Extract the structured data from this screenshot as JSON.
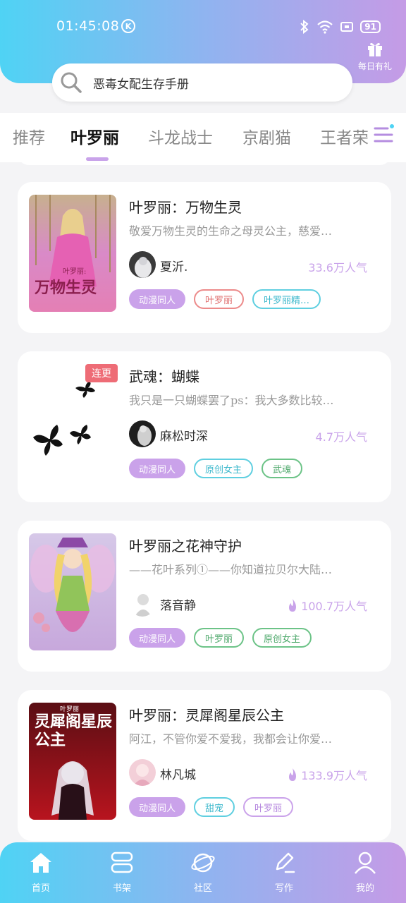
{
  "status_bar": {
    "time": "01:45:08",
    "k_icon": "K",
    "battery": "91"
  },
  "header": {
    "gift_label": "每日有礼"
  },
  "search": {
    "text": "恶毒女配生存手册"
  },
  "tabs": [
    {
      "label": "推荐",
      "active": false
    },
    {
      "label": "叶罗丽",
      "active": true
    },
    {
      "label": "斗龙战士",
      "active": false
    },
    {
      "label": "京剧猫",
      "active": false
    },
    {
      "label": "王者荣",
      "active": false
    }
  ],
  "books": [
    {
      "title": "叶罗丽：万物生灵",
      "desc": "敬爱万物生灵的生命之母灵公主，慈爱…",
      "author": "夏沂.",
      "popularity": "33.6万人气",
      "hot": false,
      "badge": "",
      "cover_title": "万物生灵",
      "cover_sub": "叶罗丽:",
      "tags": [
        "动漫同人",
        "叶罗丽",
        "叶罗丽精…"
      ]
    },
    {
      "title": "武魂：蝴蝶",
      "desc": "我只是一只蝴蝶罢了ps：我大多数比较…",
      "author": "麻松时深",
      "popularity": "4.7万人气",
      "hot": false,
      "badge": "连更",
      "tags": [
        "动漫同人",
        "原创女主",
        "武魂"
      ]
    },
    {
      "title": "叶罗丽之花神守护",
      "desc": "——花叶系列①——你知道拉贝尔大陆…",
      "author": "落音静",
      "popularity": "100.7万人气",
      "hot": true,
      "badge": "",
      "tags": [
        "动漫同人",
        "叶罗丽",
        "原创女主"
      ]
    },
    {
      "title": "叶罗丽：灵犀阁星辰公主",
      "desc": "阿江，不管你爱不爱我，我都会让你爱…",
      "author": "林凡城",
      "popularity": "133.9万人气",
      "hot": true,
      "badge": "",
      "cover_title": "灵犀阁星辰公主",
      "cover_sub": "叶罗丽",
      "tags": [
        "动漫同人",
        "甜宠",
        "叶罗丽"
      ]
    }
  ],
  "bottom_nav": [
    {
      "label": "首页",
      "icon": "home-icon",
      "active": true
    },
    {
      "label": "书架",
      "icon": "bookshelf-icon",
      "active": false
    },
    {
      "label": "社区",
      "icon": "planet-icon",
      "active": false
    },
    {
      "label": "写作",
      "icon": "pen-icon",
      "active": false
    },
    {
      "label": "我的",
      "icon": "user-icon",
      "active": false
    }
  ],
  "colors": {
    "gradient_start": "#4fd3f4",
    "gradient_end": "#c59be6",
    "accent_purple": "#caa2ea",
    "badge_red": "#ee6c76"
  }
}
